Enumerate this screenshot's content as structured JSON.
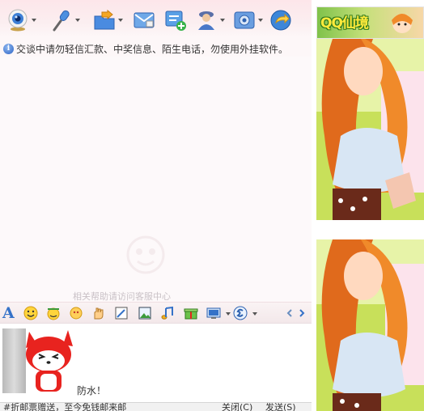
{
  "notice": {
    "text": "交谈中请勿轻信汇款、中奖信息、陌生电话，勿使用外挂软件。"
  },
  "top_toolbar": {
    "buttons": [
      {
        "icon": "webcam-icon",
        "has_menu": true
      },
      {
        "icon": "microphone-icon",
        "has_menu": true
      },
      {
        "icon": "send-file-icon",
        "has_menu": true
      },
      {
        "icon": "mail-icon",
        "has_menu": false
      },
      {
        "icon": "add-contact-icon",
        "has_menu": false
      },
      {
        "icon": "user-info-icon",
        "has_menu": true
      },
      {
        "icon": "settings-icon",
        "has_menu": true
      },
      {
        "icon": "share-icon",
        "has_menu": false
      }
    ]
  },
  "message_area": {
    "watermark_text": "相关帮助请访问客服中心"
  },
  "format_toolbar": {
    "font_label": "A",
    "icons": [
      "font-icon",
      "emoticon-icon",
      "magic-emoticon-icon",
      "shake-icon",
      "hand-icon",
      "screenshot-icon",
      "image-icon",
      "music-icon",
      "gift-icon",
      "record-icon",
      "qq-show-icon",
      "prev-icon",
      "next-icon"
    ]
  },
  "input": {
    "text": "防水！"
  },
  "bottom_bar": {
    "left_text": "#折邮票赠送，至今免钱邮来邮",
    "close_label": "关闭(C)",
    "send_label": "发送(S)"
  },
  "side_panel": {
    "ad_logo_text": "QQ仙境"
  },
  "colors": {
    "toolbar_pink": "#fde9ed",
    "accent_blue": "#3572c8",
    "mascot_red": "#e8231f"
  }
}
